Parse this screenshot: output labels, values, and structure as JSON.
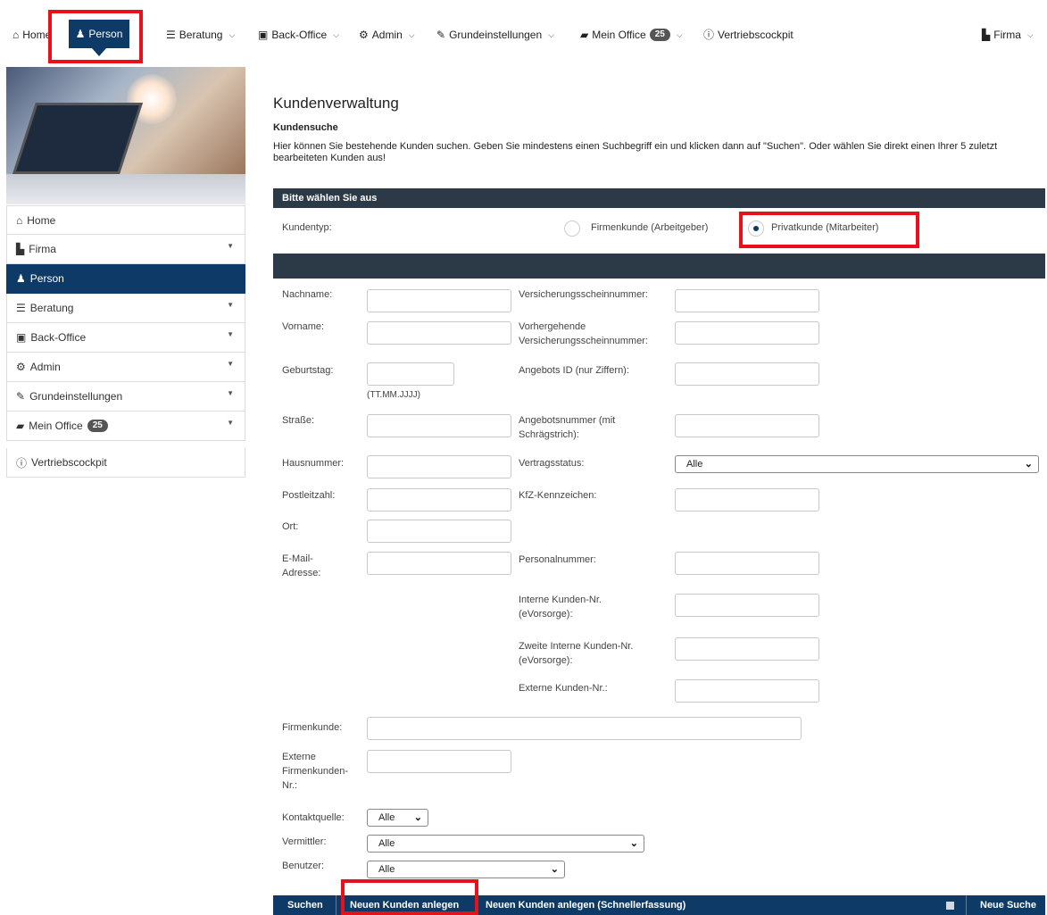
{
  "topnav": {
    "home": "Home",
    "person": "Person",
    "beratung": "Beratung",
    "backoffice": "Back-Office",
    "admin": "Admin",
    "grundeinstellungen": "Grundeinstellungen",
    "meinoffice": "Mein Office",
    "meinoffice_badge": "25",
    "vertriebscockpit": "Vertriebscockpit",
    "firma": "Firma"
  },
  "sidebar": {
    "items": [
      {
        "label": "Home",
        "icon": "home-icon"
      },
      {
        "label": "Firma",
        "icon": "industry-icon"
      },
      {
        "label": "Person",
        "icon": "user-icon"
      },
      {
        "label": "Beratung",
        "icon": "list-icon"
      },
      {
        "label": "Back-Office",
        "icon": "briefcase-icon"
      },
      {
        "label": "Admin",
        "icon": "gears-icon"
      },
      {
        "label": "Grundeinstellungen",
        "icon": "wrench-icon"
      },
      {
        "label": "Mein Office",
        "icon": "book-icon",
        "badge": "25"
      },
      {
        "label": "Vertriebscockpit",
        "icon": "info-icon"
      }
    ]
  },
  "main": {
    "title": "Kundenverwaltung",
    "subtitle": "Kundensuche",
    "description": "Hier können Sie bestehende Kunden suchen. Geben Sie mindestens einen Suchbegriff ein und klicken dann auf \"Suchen\". Oder wählen Sie direkt einen Ihrer 5 zuletzt bearbeiteten Kunden aus!",
    "choose_header": "Bitte wählen Sie aus",
    "kundentyp_label": "Kundentyp:",
    "radio_firmenkunde": "Firmenkunde (Arbeitgeber)",
    "radio_privatkunde": "Privatkunde (Mitarbeiter)"
  },
  "form": {
    "nachname": "Nachname:",
    "vorname": "Vorname:",
    "geburtstag": "Geburtstag:",
    "geburtstag_hint": "(TT.MM.JJJJ)",
    "strasse": "Straße:",
    "hausnummer": "Hausnummer:",
    "postleitzahl": "Postleitzahl:",
    "ort": "Ort:",
    "email_1": "E-Mail-",
    "email_2": "Adresse:",
    "vsnr": "Versicherungsscheinnummer:",
    "vorh_1": "Vorhergehende",
    "vorh_2": "Versicherungsscheinnummer:",
    "angebot_id": "Angebots ID (nur Ziffern):",
    "angebotsnr_1": "Angebotsnummer (mit",
    "angebotsnr_2": "Schrägstrich):",
    "vertragsstatus": "Vertragsstatus:",
    "vertragsstatus_value": "Alle",
    "kfz": "KfZ-Kennzeichen:",
    "personalnummer": "Personalnummer:",
    "intern_1": "Interne Kunden-Nr.",
    "intern_2": "(eVorsorge):",
    "zweite_1": "Zweite Interne Kunden-Nr.",
    "zweite_2": "(eVorsorge):",
    "extern": "Externe Kunden-Nr.:",
    "firmenkunde": "Firmenkunde:",
    "ext_firm_1": "Externe",
    "ext_firm_2": "Firmenkunden-",
    "ext_firm_3": "Nr.:",
    "kontaktquelle": "Kontaktquelle:",
    "kontaktquelle_value": "Alle",
    "vermittler": "Vermittler:",
    "vermittler_value": "Alle",
    "benutzer": "Benutzer:",
    "benutzer_value": "Alle"
  },
  "actions": {
    "suchen": "Suchen",
    "neuen_kunden": "Neuen Kunden anlegen",
    "neuen_kunden_schnell": "Neuen Kunden anlegen (Schnellerfassung)",
    "neue_suche": "Neue Suche"
  },
  "colors": {
    "primary": "#0d3a66",
    "header_bar": "#2b3a46",
    "highlight": "#e8101a"
  }
}
